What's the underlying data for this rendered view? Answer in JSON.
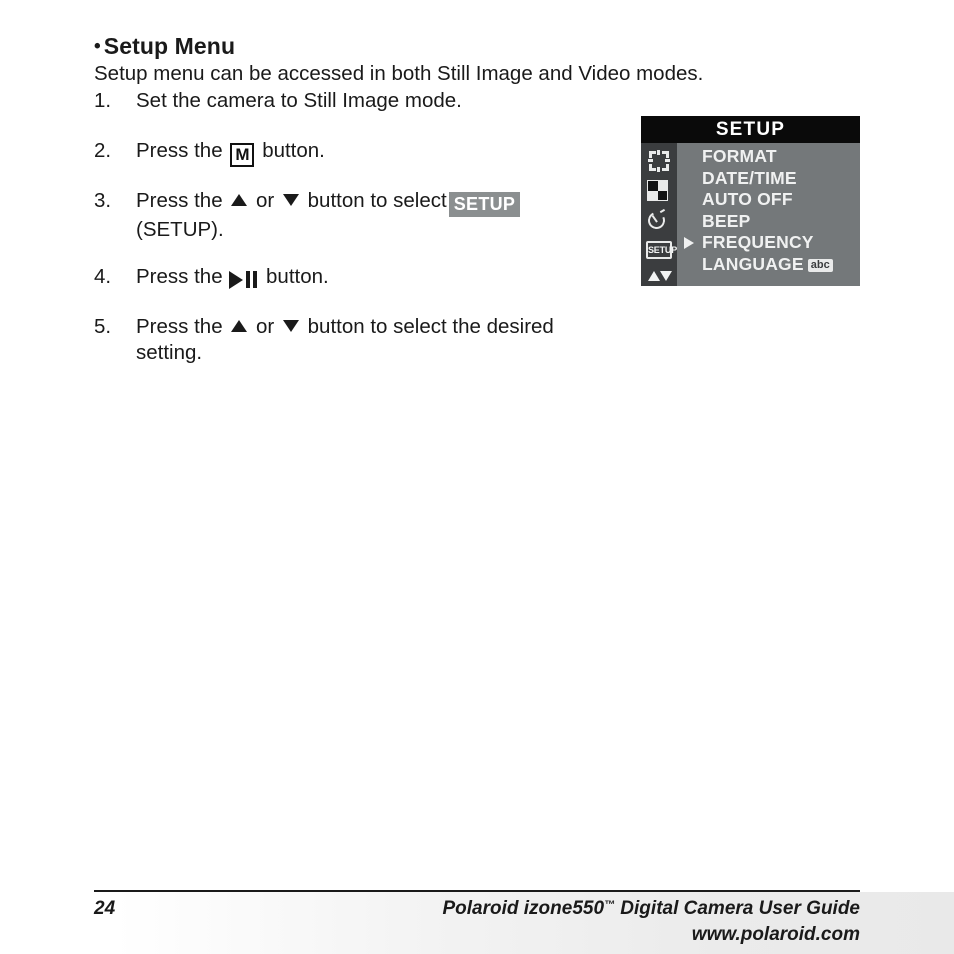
{
  "heading": {
    "bullet": "•",
    "text": "Setup Menu"
  },
  "intro": "Setup menu can be accessed in both Still Image and Video modes.",
  "steps": [
    {
      "number": "1.",
      "text": "Set the camera to Still Image mode."
    },
    {
      "number": "2.",
      "pre": "Press the",
      "glyph": "M",
      "post": "button."
    },
    {
      "number": "3.",
      "pre": "Press the",
      "mid": "or",
      "post": "button to select",
      "badge": "SETUP",
      "line2": "(SETUP)."
    },
    {
      "number": "4.",
      "pre": "Press the",
      "glyph": "play-pause",
      "post": "button."
    },
    {
      "number": "5.",
      "pre": "Press the",
      "mid": "or",
      "post": "button to select the desired",
      "line2": "setting."
    }
  ],
  "lcd": {
    "title": "SETUP",
    "icons": [
      {
        "name": "format-icon"
      },
      {
        "name": "image-quality-icon"
      },
      {
        "name": "self-timer-icon"
      },
      {
        "name": "setup-icon",
        "label": "SETUP"
      },
      {
        "name": "up-down-arrows-icon"
      }
    ],
    "items": [
      {
        "label": "FORMAT",
        "selected": false,
        "badge": ""
      },
      {
        "label": "DATE/TIME",
        "selected": false,
        "badge": ""
      },
      {
        "label": "AUTO OFF",
        "selected": false,
        "badge": ""
      },
      {
        "label": "BEEP",
        "selected": false,
        "badge": ""
      },
      {
        "label": "FREQUENCY",
        "selected": true,
        "badge": ""
      },
      {
        "label": "LANGUAGE",
        "selected": false,
        "badge": "abc"
      }
    ],
    "colors": {
      "title_bg": "#0a0a0a",
      "body_bg": "#74787a",
      "iconbar_bg": "#3b3d3f",
      "text": "#f0f1f1"
    }
  },
  "footer": {
    "page_number": "24",
    "line1_pre": "Polaroid izone550",
    "line1_tm": "™",
    "line1_post": " Digital Camera User Guide",
    "line2": "www.polaroid.com"
  }
}
